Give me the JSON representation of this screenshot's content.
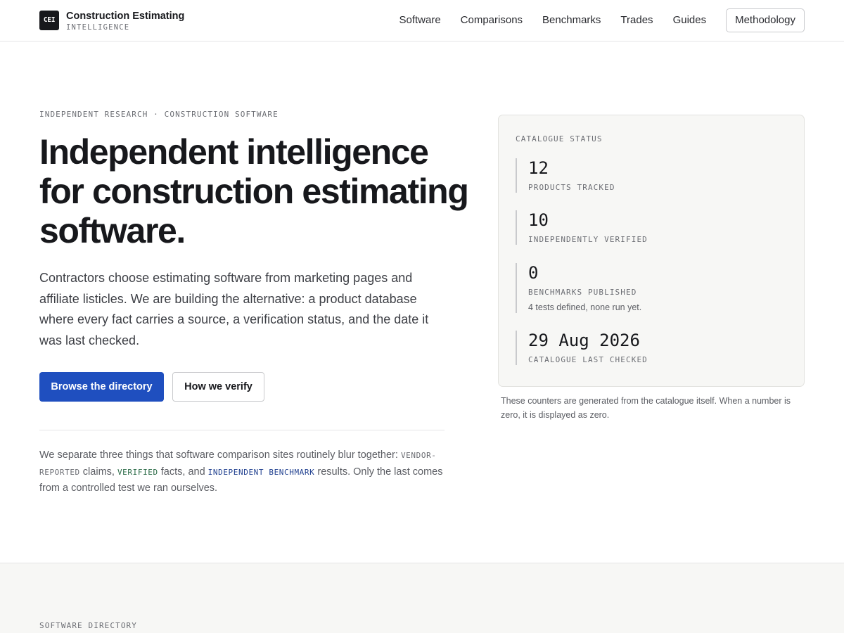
{
  "header": {
    "logo_text": "CEI",
    "brand_name": "Construction Estimating",
    "brand_sub": "INTELLIGENCE",
    "nav": [
      {
        "label": "Software"
      },
      {
        "label": "Comparisons"
      },
      {
        "label": "Benchmarks"
      },
      {
        "label": "Trades"
      },
      {
        "label": "Guides"
      }
    ],
    "cta_label": "Methodology"
  },
  "hero": {
    "eyebrow": "INDEPENDENT RESEARCH · CONSTRUCTION SOFTWARE",
    "title": "Independent intelligence for construction estimating software.",
    "lead": "Contractors choose estimating software from marketing pages and affiliate listicles. We are building the alternative: a product database where every fact carries a source, a verification status, and the date it was last checked.",
    "primary_button": "Browse the directory",
    "secondary_button": "How we verify",
    "note": {
      "intro": "We separate three things that software comparison sites routinely blur together: ",
      "tag_vendor": "VENDOR-REPORTED",
      "text_1": " claims, ",
      "tag_verified": "VERIFIED",
      "text_2": " facts, and ",
      "tag_bench": "INDEPENDENT BENCHMARK",
      "text_3": " results. Only the last comes from a controlled test we ran ourselves."
    }
  },
  "status_card": {
    "label": "CATALOGUE STATUS",
    "stats": [
      {
        "value": "12",
        "label": "PRODUCTS TRACKED",
        "note": ""
      },
      {
        "value": "10",
        "label": "INDEPENDENTLY VERIFIED",
        "note": ""
      },
      {
        "value": "0",
        "label": "BENCHMARKS PUBLISHED",
        "note": "4 tests defined, none run yet."
      },
      {
        "value": "29 Aug 2026",
        "label": "CATALOGUE LAST CHECKED",
        "note": ""
      }
    ],
    "caption": "These counters are generated from the catalogue itself. When a number is zero, it is displayed as zero."
  },
  "directory": {
    "label": "SOFTWARE DIRECTORY"
  },
  "colors": {
    "primary": "#1f4fbf",
    "text": "#17181c",
    "muted": "#6b6d73",
    "panel": "#f7f7f5",
    "verified": "#2a6a46",
    "benchmark": "#1f3f8f"
  }
}
